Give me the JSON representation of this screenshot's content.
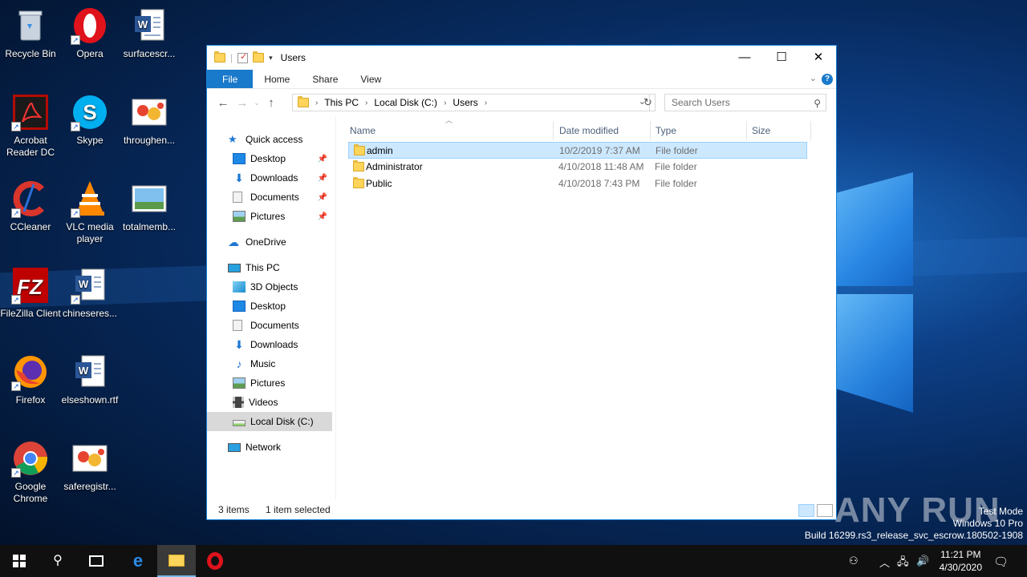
{
  "desktop": {
    "icons": [
      {
        "label": "Recycle Bin",
        "icon": "recycle-bin-icon"
      },
      {
        "label": "Opera",
        "icon": "opera-icon"
      },
      {
        "label": "surfacescr...",
        "icon": "word-document-icon"
      },
      {
        "label": "Acrobat Reader DC",
        "icon": "acrobat-icon"
      },
      {
        "label": "Skype",
        "icon": "skype-icon"
      },
      {
        "label": "throughen...",
        "icon": "image-file-icon"
      },
      {
        "label": "CCleaner",
        "icon": "ccleaner-icon"
      },
      {
        "label": "VLC media player",
        "icon": "vlc-icon"
      },
      {
        "label": "totalmemb...",
        "icon": "image-file-icon"
      },
      {
        "label": "FileZilla Client",
        "icon": "filezilla-icon"
      },
      {
        "label": "chineseres...",
        "icon": "word-document-icon"
      },
      {
        "label": "Firefox",
        "icon": "firefox-icon"
      },
      {
        "label": "elseshown.rtf",
        "icon": "word-document-icon"
      },
      {
        "label": "Google Chrome",
        "icon": "chrome-icon"
      },
      {
        "label": "saferegistr...",
        "icon": "image-file-icon"
      }
    ]
  },
  "window": {
    "title": "Users",
    "controls": {
      "minimize": "—",
      "maximize": "☐",
      "close": "✕"
    },
    "tabs": [
      "File",
      "Home",
      "Share",
      "View"
    ],
    "help": "?",
    "address": {
      "parts": [
        "This PC",
        "Local Disk (C:)",
        "Users"
      ]
    },
    "search_placeholder": "Search Users",
    "nav_pane": {
      "quick_access": "Quick access",
      "quick_items": [
        "Desktop",
        "Downloads",
        "Documents",
        "Pictures"
      ],
      "onedrive": "OneDrive",
      "this_pc": "This PC",
      "pc_items": [
        "3D Objects",
        "Desktop",
        "Documents",
        "Downloads",
        "Music",
        "Pictures",
        "Videos",
        "Local Disk (C:)"
      ],
      "network": "Network"
    },
    "columns": [
      "Name",
      "Date modified",
      "Type",
      "Size"
    ],
    "files": [
      {
        "name": "admin",
        "date": "10/2/2019 7:37 AM",
        "type": "File folder",
        "size": "",
        "selected": true
      },
      {
        "name": "Administrator",
        "date": "4/10/2018 11:48 AM",
        "type": "File folder",
        "size": "",
        "selected": false
      },
      {
        "name": "Public",
        "date": "4/10/2018 7:43 PM",
        "type": "File folder",
        "size": "",
        "selected": false
      }
    ],
    "status": {
      "count": "3 items",
      "selection": "1 item selected"
    }
  },
  "taskbar": {
    "clock_time": "11:21 PM",
    "clock_date": "4/30/2020"
  },
  "watermark": {
    "brand": "ANY RUN",
    "line1": "Test Mode",
    "line2": "Windows 10 Pro",
    "line3": "Build 16299.rs3_release_svc_escrow.180502-1908"
  },
  "colors": {
    "accent": "#1979ca",
    "selection": "#cce8ff",
    "taskbar": "#101010"
  }
}
